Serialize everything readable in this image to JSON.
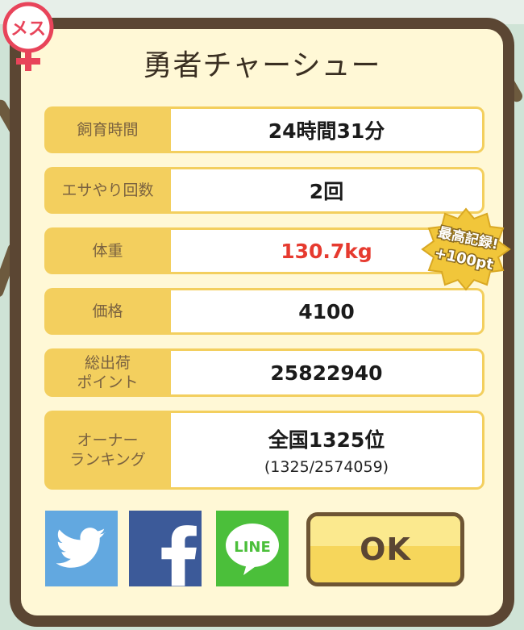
{
  "dialog": {
    "sex_badge_text": "メス",
    "title": "勇者チャーシュー",
    "rows": [
      {
        "label": "飼育時間",
        "value": "24時間31分"
      },
      {
        "label": "エサやり回数",
        "value": "2回"
      },
      {
        "label": "体重",
        "value": "130.7kg"
      },
      {
        "label": "価格",
        "value": "4100"
      },
      {
        "label_line1": "総出荷",
        "label_line2": "ポイント",
        "value": "25822940"
      },
      {
        "label_line1": "オーナー",
        "label_line2": "ランキング",
        "value": "全国1325位",
        "sub": "(1325/2574059)"
      }
    ],
    "record_badge": {
      "line1": "最高記録!",
      "line2": "+100pt"
    },
    "share": {
      "twitter": "twitter-icon",
      "facebook": "facebook-icon",
      "line": "LINE"
    },
    "ok_label": "OK"
  },
  "colors": {
    "panel_border": "#5b4633",
    "panel_bg": "#fff8d6",
    "label_bg": "#f3cf5e",
    "weight_value": "#e63a2f",
    "twitter": "#62a8e0",
    "facebook": "#3c5a99",
    "line": "#4bbf3a"
  }
}
